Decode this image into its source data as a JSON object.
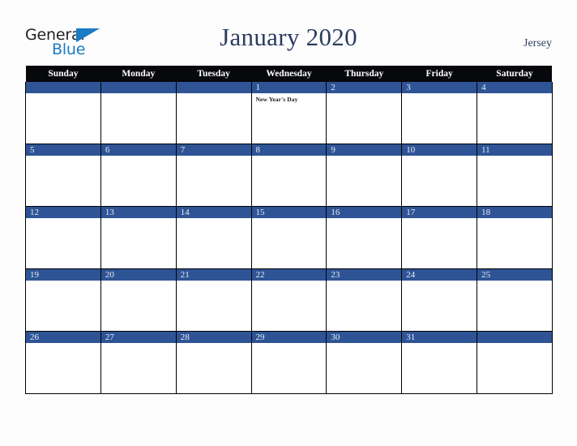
{
  "brand": {
    "name_part1": "General",
    "name_part2": "Blue",
    "triangle_color": "#1b7ac4",
    "text_color": "#231f20",
    "blue_color": "#1b7ac4"
  },
  "header": {
    "title": "January 2020",
    "region": "Jersey",
    "title_color": "#2b3c60"
  },
  "calendar": {
    "month": "January",
    "year": "2020",
    "weekday_headers": [
      "Sunday",
      "Monday",
      "Tuesday",
      "Wednesday",
      "Thursday",
      "Friday",
      "Saturday"
    ],
    "header_bg": "#07080c",
    "header_fg": "#ffffff",
    "date_band_bg": "#2e5496",
    "date_band_fg": "#e9edf5",
    "cell_bg": "#ffffff",
    "border_color": "#000000",
    "weeks": [
      [
        {
          "date": "",
          "event": ""
        },
        {
          "date": "",
          "event": ""
        },
        {
          "date": "",
          "event": ""
        },
        {
          "date": "1",
          "event": "New Year's Day"
        },
        {
          "date": "2",
          "event": ""
        },
        {
          "date": "3",
          "event": ""
        },
        {
          "date": "4",
          "event": ""
        }
      ],
      [
        {
          "date": "5",
          "event": ""
        },
        {
          "date": "6",
          "event": ""
        },
        {
          "date": "7",
          "event": ""
        },
        {
          "date": "8",
          "event": ""
        },
        {
          "date": "9",
          "event": ""
        },
        {
          "date": "10",
          "event": ""
        },
        {
          "date": "11",
          "event": ""
        }
      ],
      [
        {
          "date": "12",
          "event": ""
        },
        {
          "date": "13",
          "event": ""
        },
        {
          "date": "14",
          "event": ""
        },
        {
          "date": "15",
          "event": ""
        },
        {
          "date": "16",
          "event": ""
        },
        {
          "date": "17",
          "event": ""
        },
        {
          "date": "18",
          "event": ""
        }
      ],
      [
        {
          "date": "19",
          "event": ""
        },
        {
          "date": "20",
          "event": ""
        },
        {
          "date": "21",
          "event": ""
        },
        {
          "date": "22",
          "event": ""
        },
        {
          "date": "23",
          "event": ""
        },
        {
          "date": "24",
          "event": ""
        },
        {
          "date": "25",
          "event": ""
        }
      ],
      [
        {
          "date": "26",
          "event": ""
        },
        {
          "date": "27",
          "event": ""
        },
        {
          "date": "28",
          "event": ""
        },
        {
          "date": "29",
          "event": ""
        },
        {
          "date": "30",
          "event": ""
        },
        {
          "date": "31",
          "event": ""
        },
        {
          "date": "",
          "event": ""
        }
      ]
    ]
  }
}
